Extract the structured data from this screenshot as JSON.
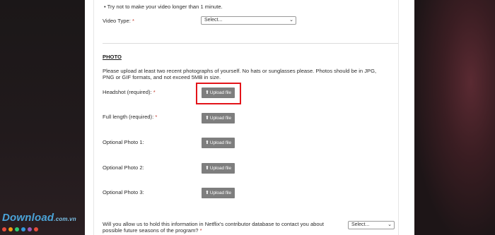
{
  "video": {
    "tip": "Try not to make your video longer than 1 minute.",
    "type_label": "Video Type:",
    "required_mark": "*",
    "type_select": "Select..."
  },
  "photo": {
    "heading": "PHOTO",
    "instructions": "Please upload at least two recent photographs of yourself. No hats or sunglasses please. Photos should be in JPG, PNG or GIF formats, and not exceed 5MB in size.",
    "upload_label": "Upload file",
    "fields": [
      {
        "label": "Headshot (required):",
        "required": "*"
      },
      {
        "label": "Full length (required):",
        "required": "*"
      },
      {
        "label": "Optional Photo 1:",
        "required": ""
      },
      {
        "label": "Optional Photo 2:",
        "required": ""
      },
      {
        "label": "Optional Photo 3:",
        "required": ""
      }
    ]
  },
  "consent": {
    "question": "Will you allow us to hold this information in Netflix's contributor database to contact you about possible future seasons of the program?",
    "required_mark": "*",
    "select": "Select..."
  },
  "watermark": {
    "text": "Download",
    "suffix": ".com.vn",
    "dot_colors": [
      "#e74c3c",
      "#f39c12",
      "#2ecc71",
      "#3498db",
      "#9b59b6",
      "#e74c3c"
    ]
  },
  "colors": {
    "highlight": "#e3141a",
    "upload_button": "#7e7e7e",
    "required": "#c0392b"
  }
}
